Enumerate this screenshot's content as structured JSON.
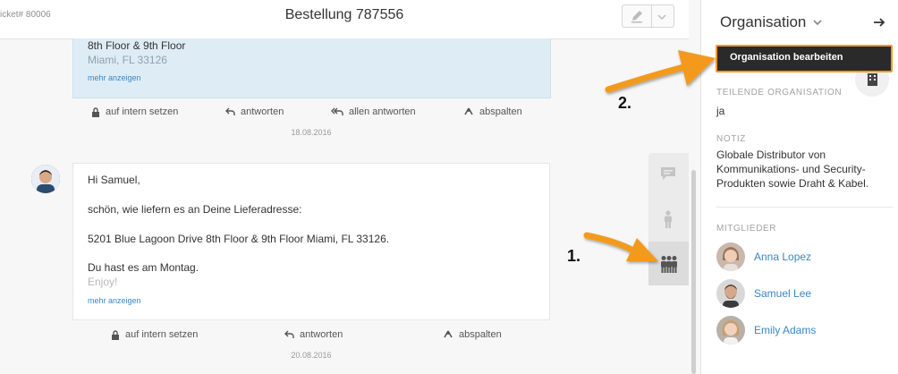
{
  "header": {
    "ticket_number": "icket# 80006",
    "title": "Bestellung 787556"
  },
  "article_top": {
    "line1": "8th Floor & 9th Floor",
    "line2": "Miami, FL 33126",
    "more": "mehr anzeigen",
    "actions": {
      "internal": "auf intern setzen",
      "reply": "antworten",
      "reply_all": "allen antworten",
      "split": "abspalten"
    },
    "date": "18.08.2016"
  },
  "article_bottom": {
    "lines": [
      "Hi Samuel,",
      "schön, wie liefern es an Deine Lieferadresse:",
      "5201 Blue Lagoon Drive 8th Floor & 9th Floor Miami, FL 33126.",
      "Du hast es am Montag.",
      "Enjoy!"
    ],
    "more": "mehr anzeigen",
    "actions": {
      "internal": "auf intern setzen",
      "reply": "antworten",
      "split": "abspalten"
    },
    "date": "20.08.2016"
  },
  "sidebar_tabs": [
    {
      "icon": "chat-icon",
      "active": false
    },
    {
      "icon": "person-icon",
      "active": false
    },
    {
      "icon": "group-icon",
      "active": true
    }
  ],
  "sidebar": {
    "title": "Organisation",
    "shared_label": "TEILENDE ORGANISATION",
    "shared_value": "ja",
    "note_label": "NOTIZ",
    "note_value": "Globale Distributor von Kommunikations- und Security-Produkten sowie Draht & Kabel.",
    "members_label": "MITGLIEDER",
    "members": [
      {
        "name": "Anna Lopez"
      },
      {
        "name": "Samuel Lee"
      },
      {
        "name": "Emily Adams"
      }
    ]
  },
  "dropdown": {
    "edit_org": "Organisation bearbeiten"
  },
  "annotations": {
    "step1": "1.",
    "step2": "2."
  },
  "colors": {
    "accent_link": "#3a86c4",
    "annotation_arrow": "#f39a1e",
    "highlight_article": "#deecf5"
  }
}
